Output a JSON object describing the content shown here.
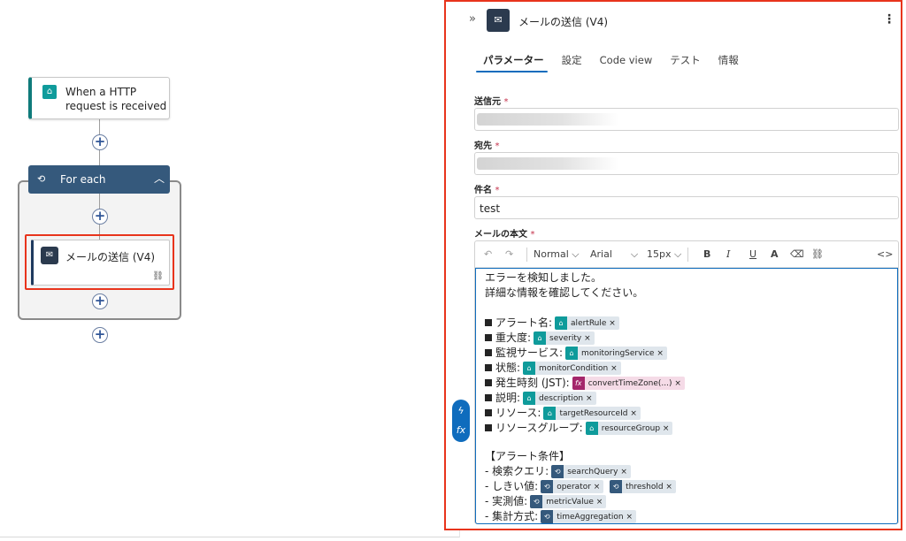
{
  "canvas": {
    "trigger": {
      "title": "When a HTTP request is received"
    },
    "foreach": {
      "label": "For each"
    },
    "action": {
      "title": "メールの送信 (V4)"
    }
  },
  "panel": {
    "title": "メールの送信 (V4)",
    "tabs": [
      "パラメーター",
      "設定",
      "Code view",
      "テスト",
      "情報"
    ],
    "active_tab": "パラメーター",
    "fields": {
      "from": {
        "label": "送信元",
        "value": ""
      },
      "to": {
        "label": "宛先",
        "value": ""
      },
      "subject": {
        "label": "件名",
        "value": "test"
      },
      "body_label": "メールの本文"
    },
    "toolbar": {
      "format": "Normal",
      "font": "Arial",
      "size": "15px",
      "bold": "B",
      "italic": "I",
      "underline": "U",
      "font_color": "A",
      "code": "<>"
    },
    "body": {
      "line1": "エラーを検知しました。",
      "line2": "詳細な情報を確認してください。",
      "items": [
        {
          "label": "アラート名:",
          "token": "alertRule",
          "kind": "trigger"
        },
        {
          "label": "重大度:",
          "token": "severity",
          "kind": "trigger"
        },
        {
          "label": "監視サービス:",
          "token": "monitoringService",
          "kind": "trigger"
        },
        {
          "label": "状態:",
          "token": "monitorCondition",
          "kind": "trigger"
        },
        {
          "label": "発生時刻 (JST):",
          "token": "convertTimeZone(...)",
          "kind": "fx"
        },
        {
          "label": "説明:",
          "token": "description",
          "kind": "trigger"
        },
        {
          "label": "リソース:",
          "token": "targetResourceId",
          "kind": "trigger"
        },
        {
          "label": "リソースグループ:",
          "token": "resourceGroup",
          "kind": "trigger"
        }
      ],
      "condition_header": "【アラート条件】",
      "conditions": [
        {
          "label": "- 検索クエリ:",
          "tokens": [
            "searchQuery"
          ]
        },
        {
          "label": "- しきい値:",
          "tokens": [
            "operator",
            "threshold"
          ]
        },
        {
          "label": "- 実測値:",
          "tokens": [
            "metricValue"
          ]
        },
        {
          "label": "- 集計方式:",
          "tokens": [
            "timeAggregation"
          ]
        }
      ]
    }
  },
  "colors": {
    "highlight": "#e8341c",
    "accent": "#0f6cbd",
    "foreach_header": "#35597c",
    "trigger_token": "#0f9b9b"
  }
}
